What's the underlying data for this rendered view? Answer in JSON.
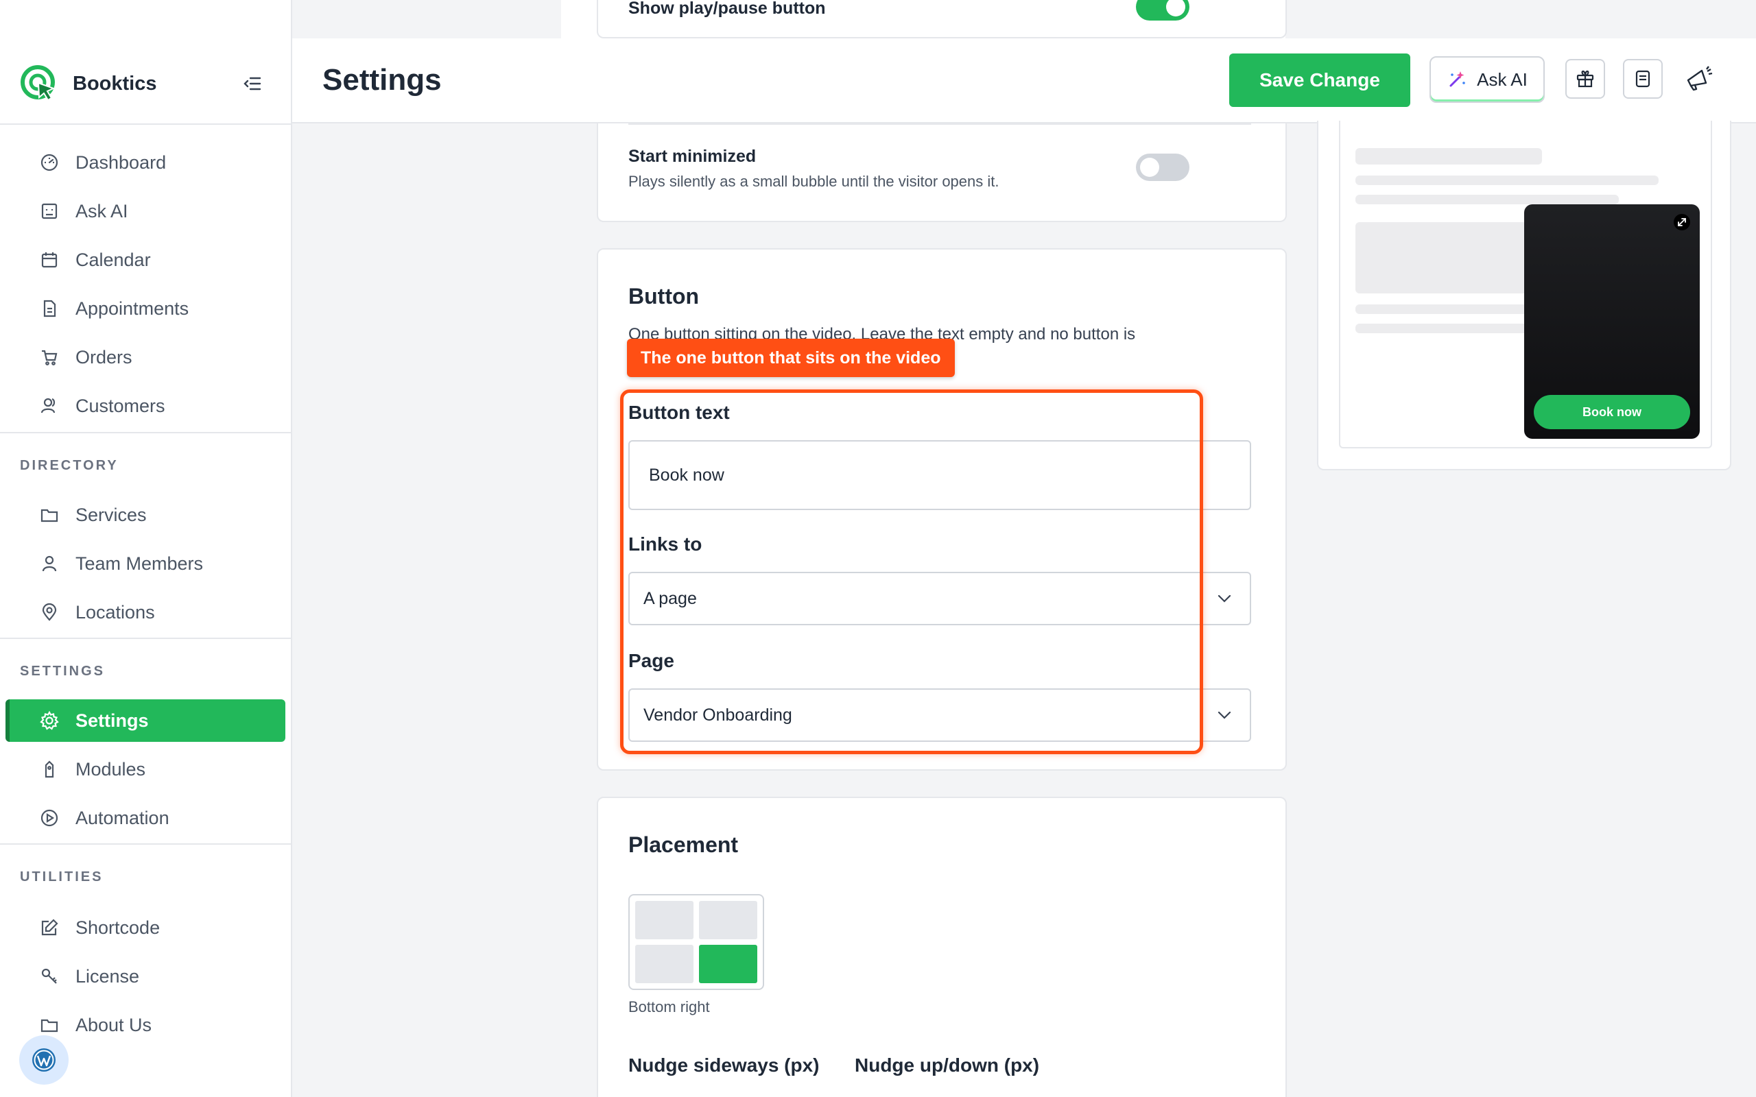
{
  "brand": {
    "name": "Booktics"
  },
  "header": {
    "title": "Settings",
    "save_label": "Save Change",
    "ask_ai_label": "Ask AI"
  },
  "sidebar": {
    "main": [
      {
        "label": "Dashboard",
        "icon": "gauge-icon"
      },
      {
        "label": "Ask AI",
        "icon": "robot-icon"
      },
      {
        "label": "Calendar",
        "icon": "calendar-icon"
      },
      {
        "label": "Appointments",
        "icon": "document-icon"
      },
      {
        "label": "Orders",
        "icon": "cart-icon"
      },
      {
        "label": "Customers",
        "icon": "users-icon"
      }
    ],
    "directory_label": "DIRECTORY",
    "directory": [
      {
        "label": "Services",
        "icon": "folder-icon"
      },
      {
        "label": "Team Members",
        "icon": "user-icon"
      },
      {
        "label": "Locations",
        "icon": "pin-icon"
      }
    ],
    "settings_label": "SETTINGS",
    "settings": [
      {
        "label": "Settings",
        "icon": "gear-icon",
        "active": true
      },
      {
        "label": "Modules",
        "icon": "tag-icon"
      },
      {
        "label": "Automation",
        "icon": "play-icon"
      }
    ],
    "utilities_label": "UTILITIES",
    "utilities": [
      {
        "label": "Shortcode",
        "icon": "edit-icon"
      },
      {
        "label": "License",
        "icon": "key-icon"
      },
      {
        "label": "About Us",
        "icon": "folder-icon"
      }
    ]
  },
  "video_card": {
    "show_play_pause_label": "Show play/pause button",
    "show_play_pause_on": true,
    "start_minimized_label": "Start minimized",
    "start_minimized_desc": "Plays silently as a small bubble until the visitor opens it.",
    "start_minimized_on": false
  },
  "button_card": {
    "title": "Button",
    "description": "One button sitting on the video. Leave the text empty and no button is",
    "tooltip": "The one button that sits on the video",
    "button_text_label": "Button text",
    "button_text_value": "Book now",
    "links_to_label": "Links to",
    "links_to_value": "A page",
    "page_label": "Page",
    "page_value": "Vendor Onboarding"
  },
  "placement_card": {
    "title": "Placement",
    "selected_position": "Bottom right",
    "nudge_sideways_label": "Nudge sideways (px)",
    "nudge_updown_label": "Nudge up/down (px)"
  },
  "preview": {
    "cta_label": "Book now"
  },
  "colors": {
    "accent": "#22b85a",
    "highlight": "#ff4f14"
  }
}
